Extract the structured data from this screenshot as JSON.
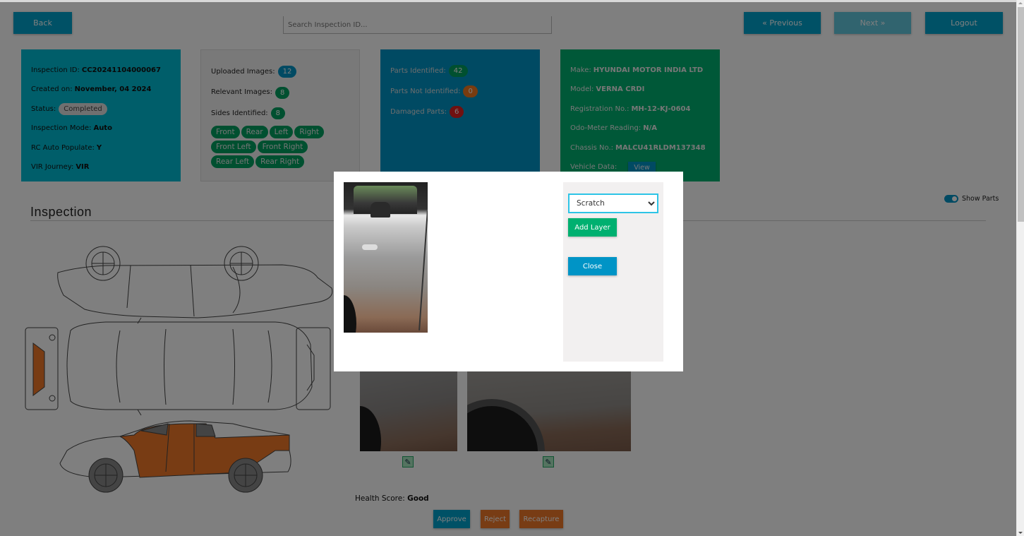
{
  "topbar": {
    "back_label": "Back",
    "search_placeholder": "Search Inspection ID...",
    "previous_label": "« Previous",
    "next_label": "Next »",
    "logout_label": "Logout"
  },
  "inspection_card": {
    "id_label": "Inspection ID:",
    "id_value": "CC20241104000067",
    "created_label": "Created on:",
    "created_value": "November, 04 2024",
    "status_label": "Status:",
    "status_value": "Completed",
    "mode_label": "Inspection Mode:",
    "mode_value": "Auto",
    "rc_label": "RC Auto Populate:",
    "rc_value": "Y",
    "journey_label": "VIR Journey:",
    "journey_value": "VIR"
  },
  "images_card": {
    "uploaded_label": "Uploaded Images:",
    "uploaded_value": "12",
    "relevant_label": "Relevant Images:",
    "relevant_value": "8",
    "sides_label": "Sides Identified:",
    "sides_value": "8",
    "sides": [
      "Front",
      "Rear",
      "Left",
      "Right",
      "Front Left",
      "Front Right",
      "Rear Left",
      "Rear Right"
    ]
  },
  "parts_card": {
    "identified_label": "Parts Identified:",
    "identified_value": "42",
    "not_identified_label": "Parts Not Identified:",
    "not_identified_value": "0",
    "damaged_label": "Damaged Parts:",
    "damaged_value": "6"
  },
  "vehicle_card": {
    "make_label": "Make:",
    "make_value": "HYUNDAI MOTOR INDIA LTD",
    "model_label": "Model:",
    "model_value": "VERNA CRDI",
    "reg_label": "Registration No.:",
    "reg_value": "MH-12-KJ-0604",
    "odo_label": "Odo-Meter Reading:",
    "odo_value": "N/A",
    "chassis_label": "Chassis No.:",
    "chassis_value": "MALCU41RLDM137348",
    "vehicle_data_label": "Vehicle Data:",
    "view_label": "View"
  },
  "inspection_section": {
    "title": "Inspection",
    "show_parts_label": "Show Parts",
    "show_parts_on": true,
    "health_label": "Health Score:",
    "health_value": "Good",
    "approve_label": "Approve",
    "reject_label": "Reject",
    "recapture_label": "Recapture",
    "damage_color": "#f07828"
  },
  "modal": {
    "damage_type_selected": "Scratch",
    "add_layer_label": "Add Layer",
    "close_label": "Close"
  },
  "icons": {
    "edit": "✎"
  }
}
